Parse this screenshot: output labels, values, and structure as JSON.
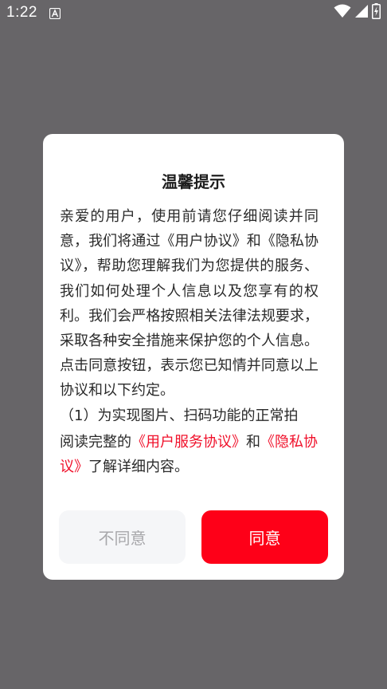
{
  "status_bar": {
    "time": "1:22",
    "icons": [
      "notification-a-icon",
      "wifi-icon",
      "signal-icon",
      "battery-charging-icon"
    ]
  },
  "dialog": {
    "title": "温馨提示",
    "body": [
      "亲爱的用户，使用前请您仔细阅读并同意，我们将通过《用户协议》和《隐私协议》，帮助您理解我们为您提供的服务、我们如何处理个人信息以及您享有的权利。我们会严格按照相关法律法规要求，采取各种安全措施来保护您的个人信息。点击同意按钮，表示您已知情并同意以上协议和以下约定。",
      "（1）为实现图片、扫码功能的正常拍"
    ],
    "footer": {
      "prefix": "阅读完整的",
      "link_user_agreement": "《用户服务协议》",
      "connector": "和",
      "link_privacy": "《隐私协议》",
      "suffix": "了解详细内容。"
    },
    "buttons": {
      "disagree": "不同意",
      "agree": "同意"
    }
  },
  "colors": {
    "scrim": "#676568",
    "accent": "#fe0018",
    "link": "#f0102a",
    "disagree_bg": "#f5f6f8",
    "disagree_text": "#a7a7aa"
  }
}
